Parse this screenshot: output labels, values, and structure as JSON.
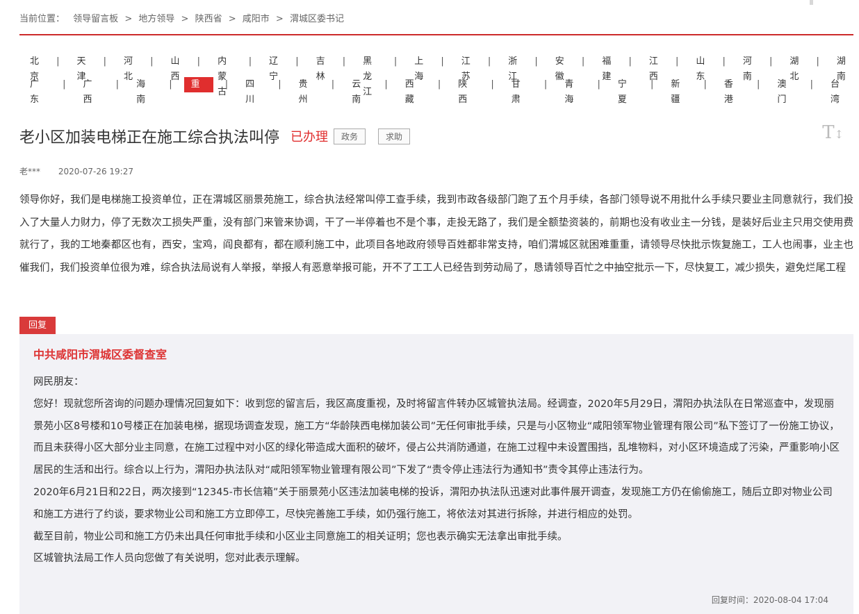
{
  "breadcrumb": {
    "label": "当前位置：",
    "items": [
      "领导留言板",
      "地方领导",
      "陕西省",
      "咸阳市",
      "渭城区委书记"
    ],
    "separator": ">"
  },
  "provinces": {
    "row1": [
      "北京",
      "天津",
      "河北",
      "山西",
      "内蒙古",
      "辽宁",
      "吉林",
      "黑龙江",
      "上海",
      "江苏",
      "浙江",
      "安徽",
      "福建",
      "江西",
      "山东",
      "河南",
      "湖北",
      "湖南"
    ],
    "row2": [
      "广东",
      "广西",
      "海南",
      "重庆",
      "四川",
      "贵州",
      "云南",
      "西藏",
      "陕西",
      "甘肃",
      "青海",
      "宁夏",
      "新疆",
      "香港",
      "澳门",
      "台湾"
    ],
    "active": "重庆",
    "separator": "|"
  },
  "message": {
    "title": "老小区加装电梯正在施工综合执法叫停",
    "status": "已办理",
    "tags": [
      "政务",
      "求助"
    ],
    "author": "老***",
    "date": "2020-07-26 19:27",
    "content": "领导你好，我们是电梯施工投资单位，正在渭城区丽景苑施工，综合执法经常叫停工查手续，我到市政各级部门跑了五个月手续，各部门领导说不用批什么手续只要业主同意就行，我们投入了大量人力财力，停了无数次工损失严重，没有部门来管来协调，干了一半停着也不是个事，走投无路了，我们是全额垫资装的，前期也没有收业主一分钱，是装好后业主只用交使用费就行了，我的工地秦都区也有，西安，宝鸡，阎良都有，都在顺利施工中，此项目各地政府领导百姓都非常支持，咱们渭城区就困难重重，请领导尽快批示恢复施工，工人也闹事，业主也催我们，我们投资单位很为难，综合执法局说有人举报，举报人有恶意举报可能，开不了工工人已经告到劳动局了，恳请领导百忙之中抽空批示一下，尽快复工，减少损失，避免烂尾工程"
  },
  "font_toggle": "T",
  "reply": {
    "tab_label": "回复",
    "organization": "中共咸阳市渭城区委督查室",
    "paragraphs": [
      "网民朋友：",
      "您好！现就您所咨询的问题办理情况回复如下：收到您的留言后，我区高度重视，及时将留言件转办区城管执法局。经调查，2020年5月29日，渭阳办执法队在日常巡查中，发现丽景苑小区8号楼和10号楼正在加装电梯，据现场调查发现，施工方“华龄陕西电梯加装公司”无任何审批手续，只是与小区物业“咸阳领军物业管理有限公司”私下签订了一份施工协议，而且未获得小区大部分业主同意，在施工过程中对小区的绿化带造成大面积的破坏，侵占公共消防通道，在施工过程中未设置围挡，乱堆物料，对小区环境造成了污染，严重影响小区居民的生活和出行。综合以上行为，渭阳办执法队对“咸阳领军物业管理有限公司”下发了“责令停止违法行为通知书”责令其停止违法行为。",
      "2020年6月21日和22日，两次接到“12345-市长信箱”关于丽景苑小区违法加装电梯的投诉，渭阳办执法队迅速对此事件展开调查，发现施工方仍在偷偷施工，随后立即对物业公司和施工方进行了约谈，要求物业公司和施工方立即停工，尽快完善施工手续，如仍强行施工，将依法对其进行拆除，并进行相应的处罚。",
      "截至目前，物业公司和施工方仍未出具任何审批手续和小区业主同意施工的相关证明；您也表示确实无法拿出审批手续。",
      "区城管执法局工作人员向您做了有关说明，您对此表示理解。"
    ],
    "time_label": "回复时间：",
    "time": "2020-08-04 17:04"
  },
  "colors": {
    "accent": "#e02e2e",
    "reply_bg": "#f2f2f6",
    "org_title": "#dd3333"
  }
}
